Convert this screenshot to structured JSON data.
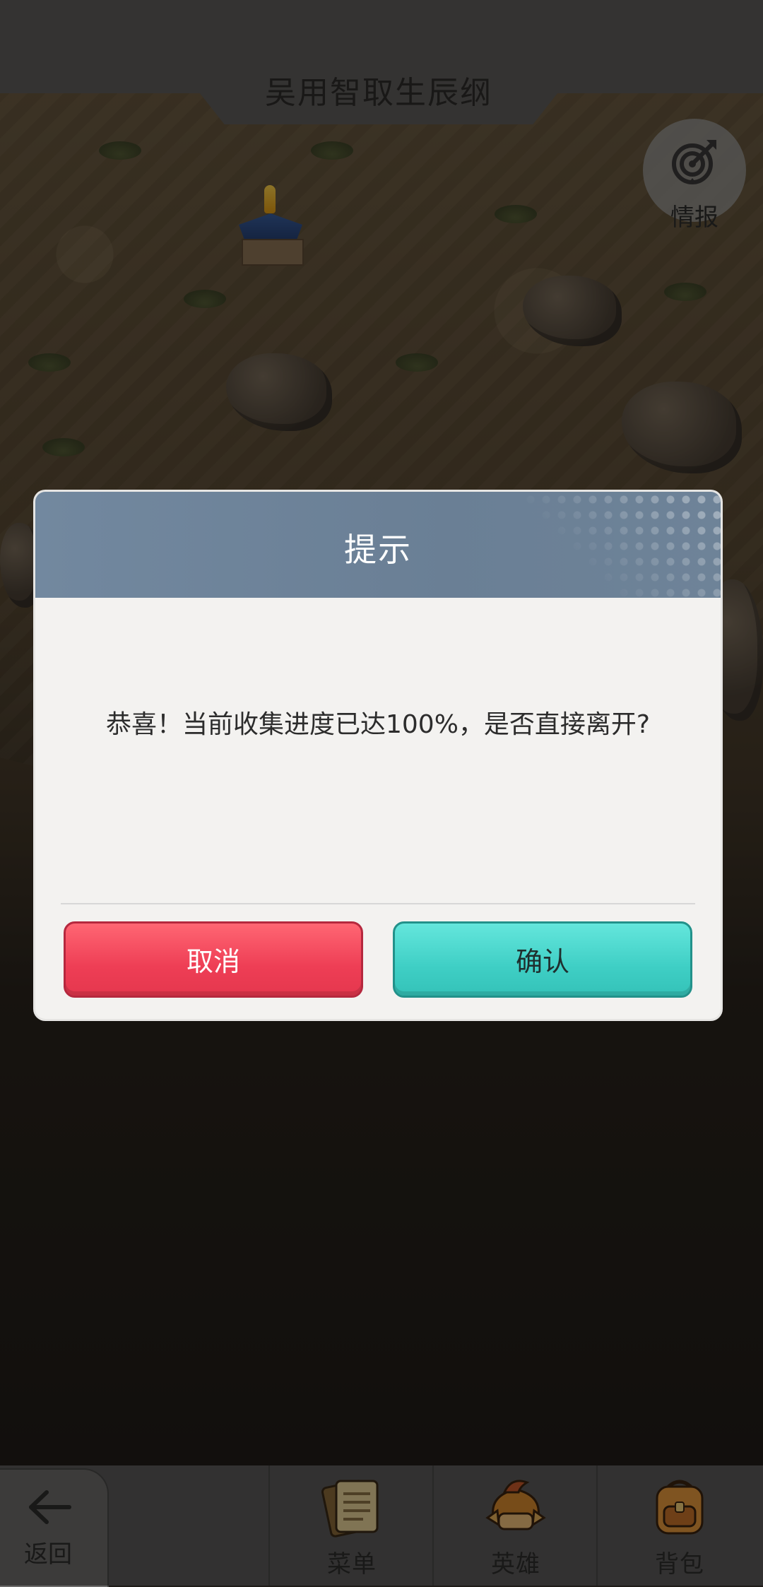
{
  "header": {
    "title": "吴用智取生辰纲"
  },
  "intel": {
    "label": "情报",
    "icon": "target-arrow-icon"
  },
  "dialog": {
    "title": "提示",
    "message": "恭喜！当前收集进度已达100%，是否直接离开?",
    "cancel_label": "取消",
    "confirm_label": "确认"
  },
  "bottom_nav": {
    "back_label": "返回",
    "items": [
      {
        "label": "菜单",
        "icon": "scroll-menu-icon"
      },
      {
        "label": "英雄",
        "icon": "hero-helmet-icon"
      },
      {
        "label": "背包",
        "icon": "backpack-icon"
      }
    ]
  },
  "colors": {
    "cancel": "#ee3e55",
    "confirm": "#3fcfc5",
    "dialog_header": "#6a7f95"
  }
}
